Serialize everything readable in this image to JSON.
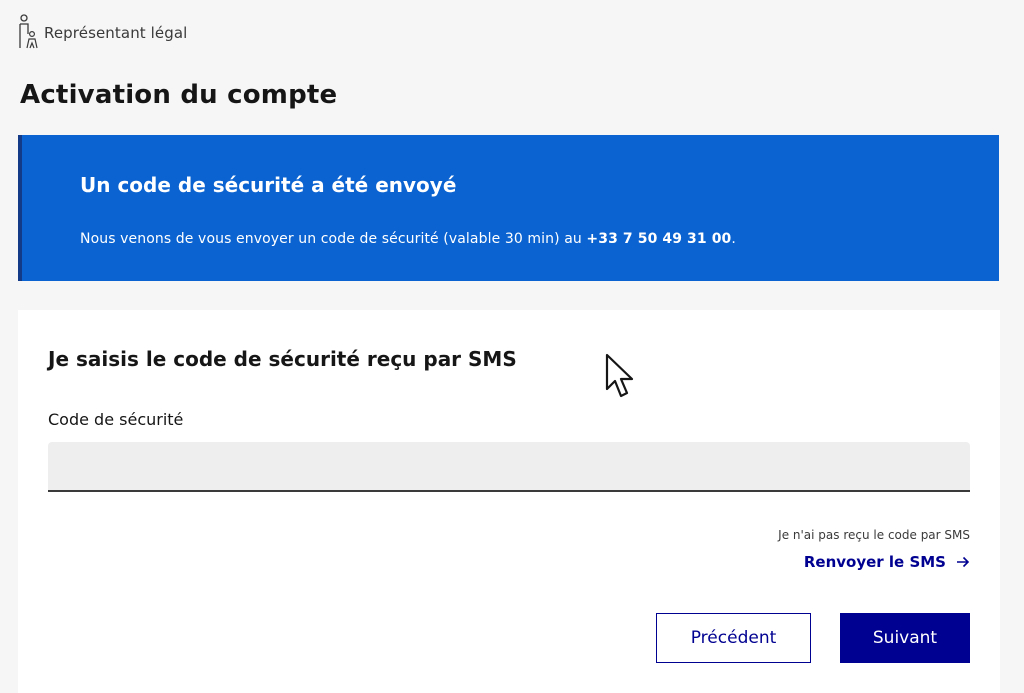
{
  "header": {
    "role_label": "Représentant légal",
    "page_title": "Activation du compte"
  },
  "notice": {
    "title": "Un code de sécurité a été envoyé",
    "text_prefix": "Nous venons de vous envoyer un code de sécurité (valable 30 min) au ",
    "phone": "+33 7 50 49 31 00",
    "text_suffix": ".",
    "background_color": "#0a63d1"
  },
  "form": {
    "title": "Je saisis le code de sécurité reçu par SMS",
    "field_label": "Code de sécurité",
    "field_value": "",
    "resend_hint": "Je n'ai pas reçu le code par SMS",
    "resend_link": "Renvoyer le SMS",
    "resend_icon": "arrow-right-icon"
  },
  "actions": {
    "previous_label": "Précédent",
    "next_label": "Suivant",
    "primary_color": "#000091"
  },
  "icons": {
    "role": "person-child-icon",
    "pointer": "mouse-cursor-icon"
  }
}
